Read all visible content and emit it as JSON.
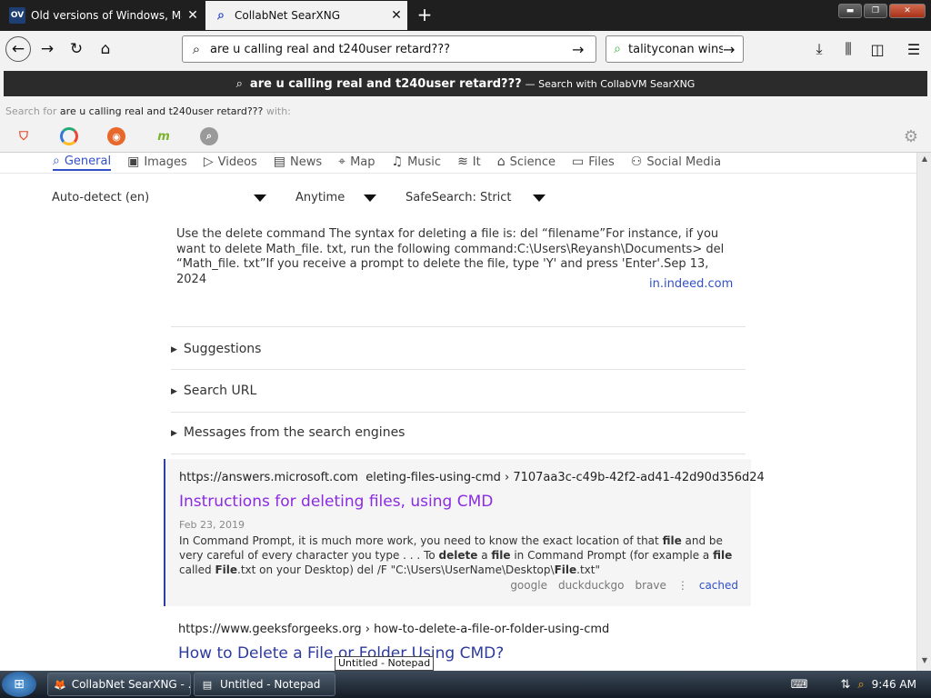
{
  "browser": {
    "tabs": [
      {
        "title": "Old versions of Windows, Mac and",
        "favicon": "OV"
      },
      {
        "title": "CollabNet SearXNG"
      }
    ],
    "new_tab": "+",
    "address": "are u calling real and t240user retard???",
    "search_box": "talityconan wins",
    "dropdown": {
      "query": "are u calling real and t240user retard???",
      "suffix": "— Search with CollabVM SearXNG",
      "search_for_prefix": "Search for",
      "search_for_query": "are u calling real and t240user retard???",
      "search_for_suffix": "with:",
      "engines": [
        "brave-icon",
        "qwant-icon",
        "duckduckgo-icon",
        "mojeek-icon",
        "searx-icon"
      ]
    }
  },
  "searx": {
    "categories": [
      {
        "label": "General",
        "icon": "⌕",
        "active": true
      },
      {
        "label": "Images",
        "icon": "▣"
      },
      {
        "label": "Videos",
        "icon": "▷"
      },
      {
        "label": "News",
        "icon": "▤"
      },
      {
        "label": "Map",
        "icon": "⌖"
      },
      {
        "label": "Music",
        "icon": "♫"
      },
      {
        "label": "It",
        "icon": "≋"
      },
      {
        "label": "Science",
        "icon": "⌂"
      },
      {
        "label": "Files",
        "icon": "▭"
      },
      {
        "label": "Social Media",
        "icon": "⚇"
      }
    ],
    "filters": {
      "language": "Auto-detect (en)",
      "time": "Anytime",
      "safesearch": "SafeSearch: Strict"
    },
    "answer": {
      "text": "Use the delete command The syntax for deleting a file is: del “filename”For instance, if you want to delete Math_file. txt, run the following command:C:\\Users\\Reyansh\\Documents> del “Math_file. txt”If you receive a prompt to delete the file, type 'Y' and press 'Enter'.Sep 13, 2024",
      "source": "in.indeed.com"
    },
    "sections": [
      "Suggestions",
      "Search URL",
      "Messages from the search engines"
    ],
    "results": [
      {
        "url": "https://answers.microsoft.com   eleting-files-using-cmd › 7107aa3c-c49b-42f2-ad41-42d90d356d24",
        "title": "Instructions for deleting files, using CMD",
        "date": "Feb 23, 2019",
        "snippet_html": "In Command Prompt, it is much more work, you need to know the exact location of that <b>file</b> and be very careful of every character you type . . . To <b>delete</b> a <b>file</b> in Command Prompt (for example a <b>file</b> called <b>File</b>.txt on your Desktop) del /F \"C:\\Users\\UserName\\Desktop\\<b>File</b>.txt\"",
        "engines": [
          "google",
          "duckduckgo",
          "brave"
        ],
        "cached": "cached"
      },
      {
        "url": "https://www.geeksforgeeks.org  › how-to-delete-a-file-or-folder-using-cmd",
        "title": "How to Delete a File or Folder Using CMD?"
      }
    ]
  },
  "taskbar": {
    "tasks": [
      {
        "label": "CollabNet SearXNG - ..."
      },
      {
        "label": "Untitled - Notepad"
      }
    ],
    "tooltip": "Untitled - Notepad",
    "time": "9:46 AM"
  }
}
